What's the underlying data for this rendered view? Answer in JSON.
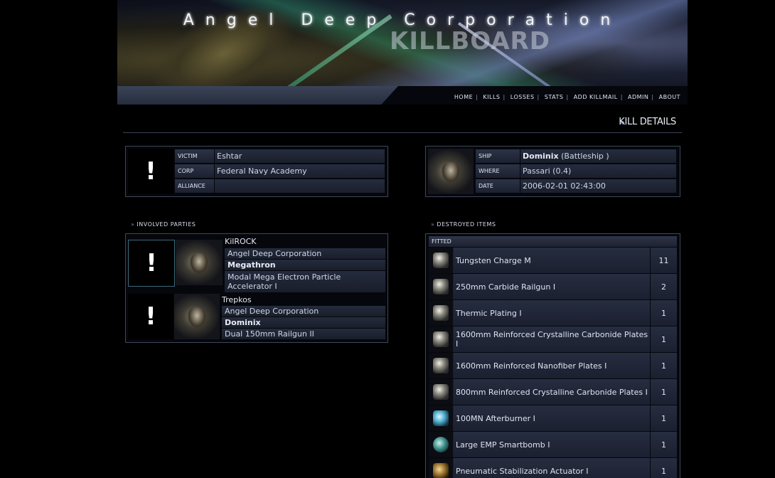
{
  "header": {
    "title": "Angel Deep Corporation",
    "logo_text": "KILLBOARD"
  },
  "nav": {
    "items": [
      "HOME",
      "KILLS",
      "LOSSES",
      "STATS",
      "ADD KILLMAIL",
      "ADMIN",
      "ABOUT"
    ]
  },
  "section_title": "KILL DETAILS",
  "victim": {
    "portrait_glyph": "!",
    "labels": {
      "victim": "VICTIM",
      "corp": "CORP",
      "alliance": "ALLIANCE"
    },
    "name": "Eshtar",
    "corp": "Federal Navy Academy",
    "alliance": ""
  },
  "ship_info": {
    "labels": {
      "ship": "SHIP",
      "where": "WHERE",
      "date": "DATE"
    },
    "ship_name": "Dominix",
    "ship_class": "(Battleship )",
    "where": "Passari (0.4)",
    "date": "2006-02-01 02:43:00"
  },
  "involved": {
    "heading": "INVOLVED PARTIES",
    "parties": [
      {
        "portrait_glyph": "!",
        "name": "KilROCK",
        "corp": "Angel Deep Corporation",
        "ship": "Megathron",
        "weapon": "Modal Mega Electron Particle Accelerator I"
      },
      {
        "portrait_glyph": "!",
        "name": "Trepkos",
        "corp": "Angel Deep Corporation",
        "ship": "Dominix",
        "weapon": "Dual 150mm Railgun II"
      }
    ]
  },
  "destroyed": {
    "heading": "DESTROYED ITEMS",
    "section_label": "FITTED",
    "items": [
      {
        "name": "Tungsten Charge M",
        "qty": "11",
        "icon": "ammo-icon"
      },
      {
        "name": "250mm Carbide Railgun I",
        "qty": "2",
        "icon": "railgun-icon"
      },
      {
        "name": "Thermic Plating I",
        "qty": "1",
        "icon": "plating-icon"
      },
      {
        "name": "1600mm Reinforced Crystalline Carbonide Plates I",
        "qty": "1",
        "icon": "armor-plate-icon"
      },
      {
        "name": "1600mm Reinforced Nanofiber Plates I",
        "qty": "1",
        "icon": "armor-plate-icon"
      },
      {
        "name": "800mm Reinforced Crystalline Carbonide Plates I",
        "qty": "1",
        "icon": "armor-plate-icon"
      },
      {
        "name": "100MN Afterburner I",
        "qty": "1",
        "icon": "afterburner-icon"
      },
      {
        "name": "Large EMP Smartbomb I",
        "qty": "1",
        "icon": "smartbomb-icon"
      },
      {
        "name": "Pneumatic Stabilization Actuator I",
        "qty": "1",
        "icon": "actuator-icon"
      }
    ]
  }
}
